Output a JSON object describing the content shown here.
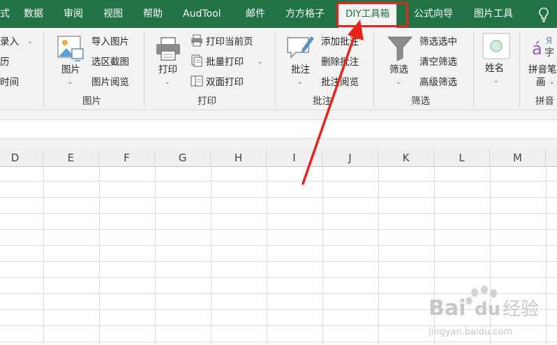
{
  "tabs": [
    {
      "label": "式"
    },
    {
      "label": "数据"
    },
    {
      "label": "审阅"
    },
    {
      "label": "视图"
    },
    {
      "label": "帮助"
    },
    {
      "label": "AudTool"
    },
    {
      "label": "邮件"
    },
    {
      "label": "方方格子"
    },
    {
      "label": "DIY工具箱",
      "active": true
    },
    {
      "label": "公式向导"
    },
    {
      "label": "图片工具"
    }
  ],
  "ribbon": {
    "partial": {
      "item1": "录入",
      "item2": "历",
      "item3": "时间"
    },
    "picture": {
      "big_label": "图片",
      "items": [
        "导入图片",
        "选区截图",
        "图片阅览"
      ],
      "group_label": "图片"
    },
    "print": {
      "big_label": "打印",
      "items": [
        "打印当前页",
        "批量打印",
        "双面打印"
      ],
      "group_label": "打印"
    },
    "comment": {
      "big_label": "批注",
      "items": [
        "添加批注",
        "删除批注",
        "批注阅览"
      ],
      "group_label": "批注"
    },
    "filter": {
      "big_label": "筛选",
      "items": [
        "筛选选中",
        "清空筛选",
        "高级筛选"
      ],
      "group_label": "筛选"
    },
    "name": {
      "big_label": "姓名"
    },
    "pinyin": {
      "big_label_1": "拼音笔",
      "big_label_2": "画",
      "group_label": "拼音",
      "icon_glyph_1": "á",
      "icon_glyph_2": "Я",
      "icon_glyph_3": "字"
    }
  },
  "columns": [
    "D",
    "E",
    "F",
    "G",
    "H",
    "I",
    "J",
    "K",
    "L",
    "M"
  ],
  "watermark": {
    "brand_1": "Bai",
    "brand_2": "du",
    "brand_3": "经验",
    "url": "jingyan.baidu.com"
  },
  "colors": {
    "accent": "#217346",
    "highlight": "#e8231c"
  }
}
